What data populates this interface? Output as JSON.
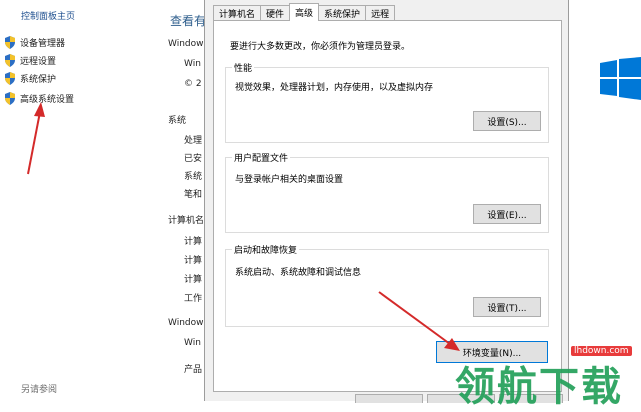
{
  "sidebar": {
    "home": "控制面板主页",
    "items": [
      "设备管理器",
      "远程设置",
      "系统保护",
      "高级系统设置"
    ],
    "see_also": "另请参阅"
  },
  "background": {
    "title": "查看有",
    "windows_edition_heading": "Window",
    "edition_line1": "Win",
    "edition_line2": "© 2",
    "system_heading": "系统",
    "system_rows": [
      "处理",
      "已安",
      "系统",
      "笔和"
    ],
    "computer_heading": "计算机名",
    "computer_rows": [
      "计算",
      "计算",
      "计算",
      "工作"
    ],
    "activation_heading": "Window",
    "activation_rows": [
      "Win",
      "产品"
    ]
  },
  "dialog": {
    "tabs": [
      "计算机名",
      "硬件",
      "高级",
      "系统保护",
      "远程"
    ],
    "active_tab": 2,
    "admin_note": "要进行大多数更改，你必须作为管理员登录。",
    "performance": {
      "title": "性能",
      "desc": "视觉效果，处理器计划，内存使用，以及虚拟内存",
      "button": "设置(S)..."
    },
    "user_profiles": {
      "title": "用户配置文件",
      "desc": "与登录帐户相关的桌面设置",
      "button": "设置(E)..."
    },
    "startup_recovery": {
      "title": "启动和故障恢复",
      "desc": "系统启动、系统故障和调试信息",
      "button": "设置(T)..."
    },
    "env_button": "环境变量(N)..."
  },
  "watermark": {
    "url": "lhdown.com",
    "text": "领航下载"
  },
  "colors": {
    "accent": "#0078d7",
    "arrow": "#d42a2a",
    "logo": "#0078d7"
  }
}
